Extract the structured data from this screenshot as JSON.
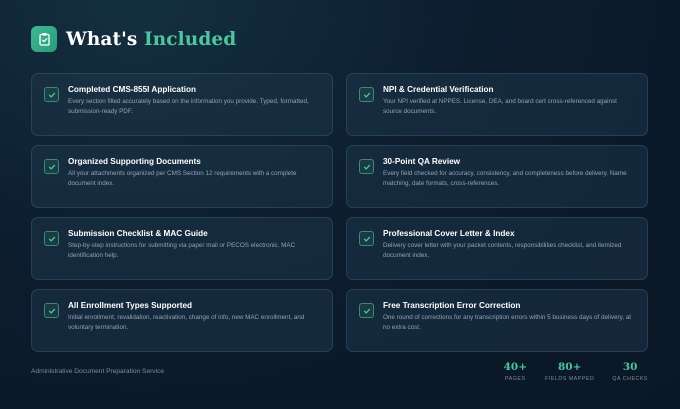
{
  "header": {
    "title_main": "What's ",
    "title_accent": "Included"
  },
  "colors": {
    "accent": "#4cc79d",
    "background": "#0c1d2e"
  },
  "icons": {
    "header": "clipboard-icon",
    "card": "check-icon"
  },
  "cards": [
    {
      "title": "Completed CMS-855I Application",
      "description": "Every section filled accurately based on the information you provide. Typed, formatted, submission-ready PDF."
    },
    {
      "title": "NPI & Credential Verification",
      "description": "Your NPI verified at NPPES. License, DEA, and board cert cross-referenced against source documents."
    },
    {
      "title": "Organized Supporting Documents",
      "description": "All your attachments organized per CMS Section 12 requirements with a complete document index."
    },
    {
      "title": "30-Point QA Review",
      "description": "Every field checked for accuracy, consistency, and completeness before delivery. Name matching, date formats, cross-references."
    },
    {
      "title": "Submission Checklist & MAC Guide",
      "description": "Step-by-step instructions for submitting via paper mail or PECOS electronic. MAC identification help."
    },
    {
      "title": "Professional Cover Letter & Index",
      "description": "Delivery cover letter with your packet contents, responsibilities checklist, and itemized document index."
    },
    {
      "title": "All Enrollment Types Supported",
      "description": "Initial enrollment, revalidation, reactivation, change of info, new MAC enrollment, and voluntary termination."
    },
    {
      "title": "Free Transcription Error Correction",
      "description": "One round of corrections for any transcription errors within 5 business days of delivery, at no extra cost."
    }
  ],
  "footer": {
    "tagline": "Administrative Document Preparation Service",
    "stats": [
      {
        "value": "40+",
        "label": "PAGES"
      },
      {
        "value": "80+",
        "label": "FIELDS MAPPED"
      },
      {
        "value": "30",
        "label": "QA CHECKS"
      }
    ]
  }
}
